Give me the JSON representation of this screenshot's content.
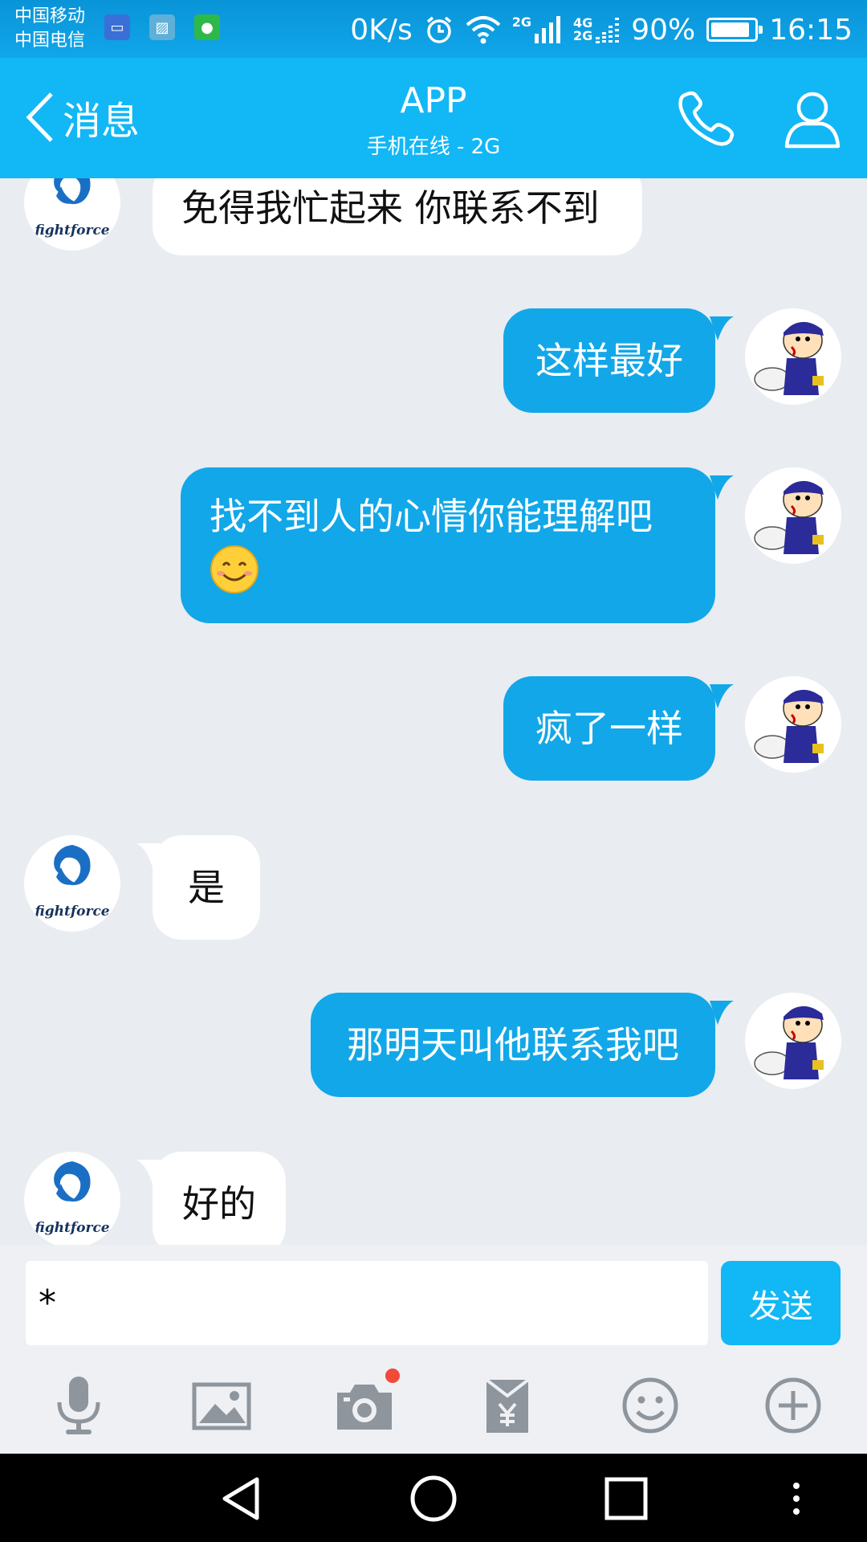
{
  "status_bar": {
    "carrier_1": "中国移动",
    "carrier_2": "中国电信",
    "net_speed": "0K/s",
    "sim1_net": "2G",
    "sim2_net_top": "4G",
    "sim2_net_bottom": "2G",
    "battery_percent": "90%",
    "battery_level": 0.9,
    "time": "16:15"
  },
  "nav": {
    "back_label": "消息",
    "title": "APP",
    "subtitle": "手机在线 - 2G"
  },
  "contacts": {
    "them_logo_text": "fightforce"
  },
  "messages": [
    {
      "side": "in",
      "text": "免得我忙起来 你联系不到"
    },
    {
      "side": "out",
      "text": "这样最好"
    },
    {
      "side": "out",
      "text": "找不到人的心情你能理解吧",
      "emoji": "😊"
    },
    {
      "side": "out",
      "text": "疯了一样"
    },
    {
      "side": "in",
      "text": "是"
    },
    {
      "side": "out",
      "text": "那明天叫他联系我吧"
    },
    {
      "side": "in",
      "text": "好的"
    }
  ],
  "input": {
    "value": "*",
    "send_label": "发送"
  },
  "toolbar": {
    "icons": [
      "microphone-icon",
      "image-icon",
      "camera-icon",
      "red-packet-icon",
      "emoji-icon",
      "plus-icon"
    ]
  },
  "colors": {
    "nav_bg": "#12b7f5",
    "bubble_out": "#12a7e8",
    "bubble_in": "#ffffff",
    "chat_bg": "#e9ecf1"
  }
}
